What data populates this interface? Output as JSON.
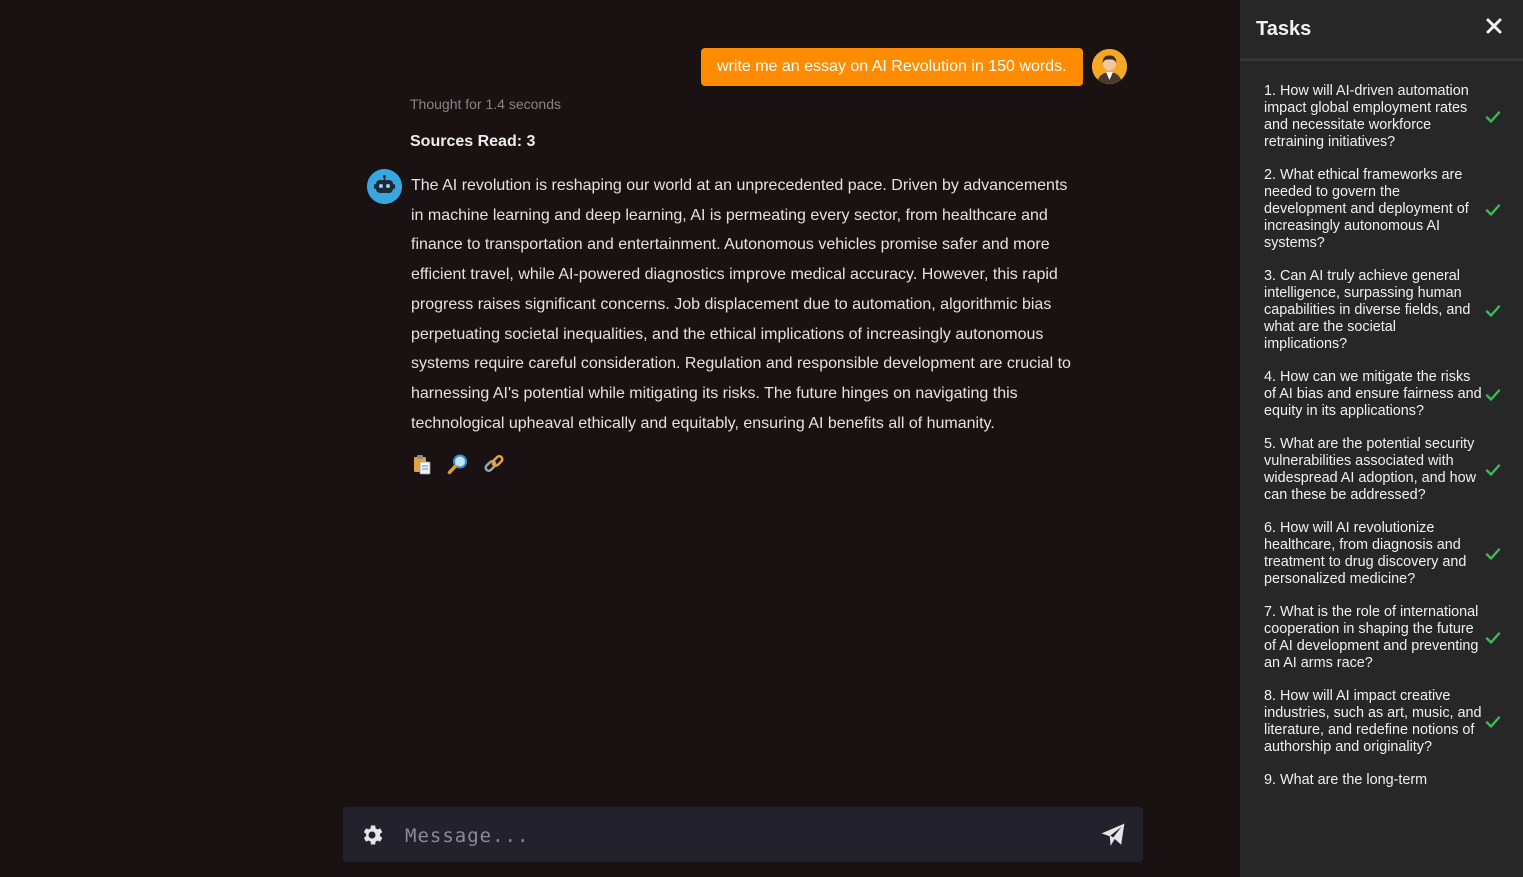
{
  "user_message": "write me an essay on AI Revolution in 150 words.",
  "assistant": {
    "thought": "Thought for 1.4 seconds",
    "sources": "Sources Read: 3",
    "response": "The AI revolution is reshaping our world at an unprecedented pace. Driven by advancements in machine learning and deep learning, AI is permeating every sector, from healthcare and finance to transportation and entertainment. Autonomous vehicles promise safer and more efficient travel, while AI-powered diagnostics improve medical accuracy. However, this rapid progress raises significant concerns. Job displacement due to automation, algorithmic bias perpetuating societal inequalities, and the ethical implications of increasingly autonomous systems require careful consideration. Regulation and responsible development are crucial to harnessing AI's potential while mitigating its risks. The future hinges on navigating this technological upheaval ethically and equitably, ensuring AI benefits all of humanity.",
    "action_icons": [
      "clipboard-icon",
      "magnifier-icon",
      "link-icon"
    ],
    "action_glyphs": [
      "📋",
      "🔎",
      "🔗"
    ]
  },
  "composer": {
    "placeholder": "Message..."
  },
  "tasks_panel": {
    "title": "Tasks",
    "items": [
      {
        "label": "1. How will AI-driven automation impact global employment rates and necessitate workforce retraining initiatives?",
        "done": true
      },
      {
        "label": "2. What ethical frameworks are needed to govern the development and deployment of increasingly autonomous AI systems?",
        "done": true
      },
      {
        "label": "3. Can AI truly achieve general intelligence, surpassing human capabilities in diverse fields, and what are the societal implications?",
        "done": true
      },
      {
        "label": "4. How can we mitigate the risks of AI bias and ensure fairness and equity in its applications?",
        "done": true
      },
      {
        "label": "5. What are the potential security vulnerabilities associated with widespread AI adoption, and how can these be addressed?",
        "done": true
      },
      {
        "label": "6. How will AI revolutionize healthcare, from diagnosis and treatment to drug discovery and personalized medicine?",
        "done": true
      },
      {
        "label": "7. What is the role of international cooperation in shaping the future of AI development and preventing an AI arms race?",
        "done": true
      },
      {
        "label": "8. How will AI impact creative industries, such as art, music, and literature, and redefine notions of authorship and originality?",
        "done": true
      },
      {
        "label": "9. What are the long-term",
        "done": false
      }
    ]
  },
  "colors": {
    "background": "#1a1112",
    "user_bubble": "#ff8c00",
    "panel": "#272727",
    "input_bar": "#23222c",
    "check": "#3cba54"
  }
}
